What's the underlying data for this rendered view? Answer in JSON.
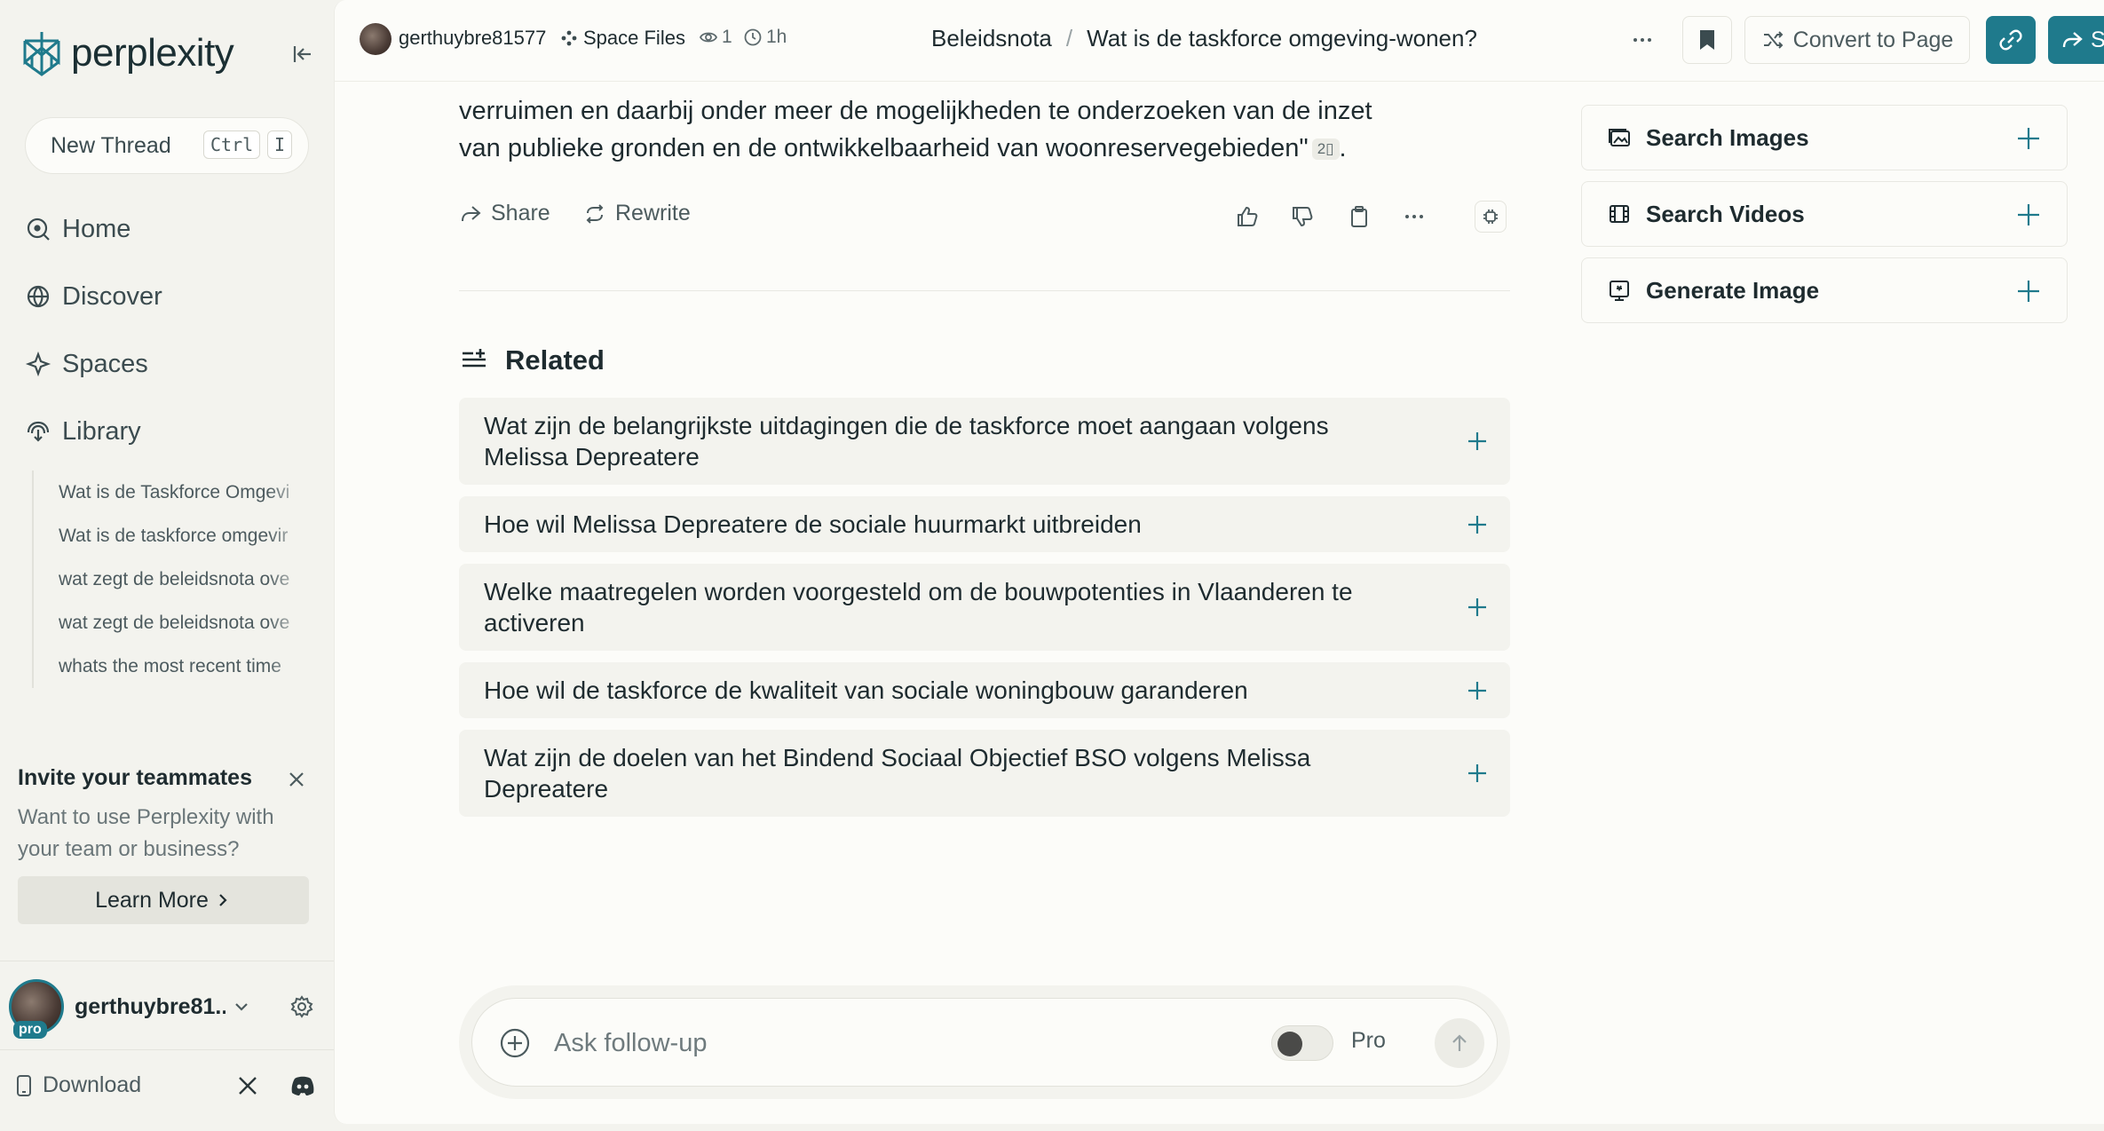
{
  "brand": {
    "name": "perplexity"
  },
  "sidebar": {
    "new_thread": {
      "label": "New Thread",
      "kbd_ctrl": "Ctrl",
      "kbd_key": "I"
    },
    "nav": [
      {
        "label": "Home",
        "icon": "home-icon"
      },
      {
        "label": "Discover",
        "icon": "globe-icon"
      },
      {
        "label": "Spaces",
        "icon": "spaces-icon"
      },
      {
        "label": "Library",
        "icon": "library-icon"
      }
    ],
    "library_items": [
      "Wat is de Taskforce Omgevi",
      "Wat is de taskforce omgevir",
      "wat zegt de beleidsnota ove",
      "wat zegt de beleidsnota ove",
      "whats the most recent time"
    ],
    "invite": {
      "title": "Invite your teammates",
      "text": "Want to use Perplexity with your team or business?",
      "button": "Learn More"
    },
    "user": {
      "name": "gerthuybre81...",
      "badge": "pro"
    },
    "download": "Download"
  },
  "topbar": {
    "user": "gerthuybre81577",
    "space": "Space Files",
    "views": "1",
    "time": "1h",
    "breadcrumb": {
      "parent": "Beleidsnota",
      "current": "Wat is de taskforce omgeving-wonen?"
    },
    "convert_label": "Convert to Page",
    "share_label": "S"
  },
  "answer": {
    "text": "verruimen en daarbij onder meer de mogelijkheden te onderzoeken van de inzet van publieke gronden en de ontwikkelbaarheid van woonreservegebieden\"",
    "citation": "2",
    "trailing": "."
  },
  "actions": {
    "share": "Share",
    "rewrite": "Rewrite"
  },
  "related": {
    "title": "Related",
    "items": [
      "Wat zijn de belangrijkste uitdagingen die de taskforce moet aangaan volgens Melissa Depreatere",
      "Hoe wil Melissa Depreatere de sociale huurmarkt uitbreiden",
      "Welke maatregelen worden voorgesteld om de bouwpotenties in Vlaanderen te activeren",
      "Hoe wil de taskforce de kwaliteit van sociale woningbouw garanderen",
      "Wat zijn de doelen van het Bindend Sociaal Objectief BSO volgens Melissa Depreatere"
    ]
  },
  "right_panel": [
    {
      "label": "Search Images",
      "icon": "image-icon"
    },
    {
      "label": "Search Videos",
      "icon": "video-icon"
    },
    {
      "label": "Generate Image",
      "icon": "generate-image-icon"
    }
  ],
  "ask": {
    "placeholder": "Ask follow-up",
    "pro_label": "Pro",
    "pro_enabled": false
  },
  "colors": {
    "accent": "#1f7a8c",
    "sidebar_bg": "#f3f3ee",
    "main_bg": "#fcfcf9"
  }
}
